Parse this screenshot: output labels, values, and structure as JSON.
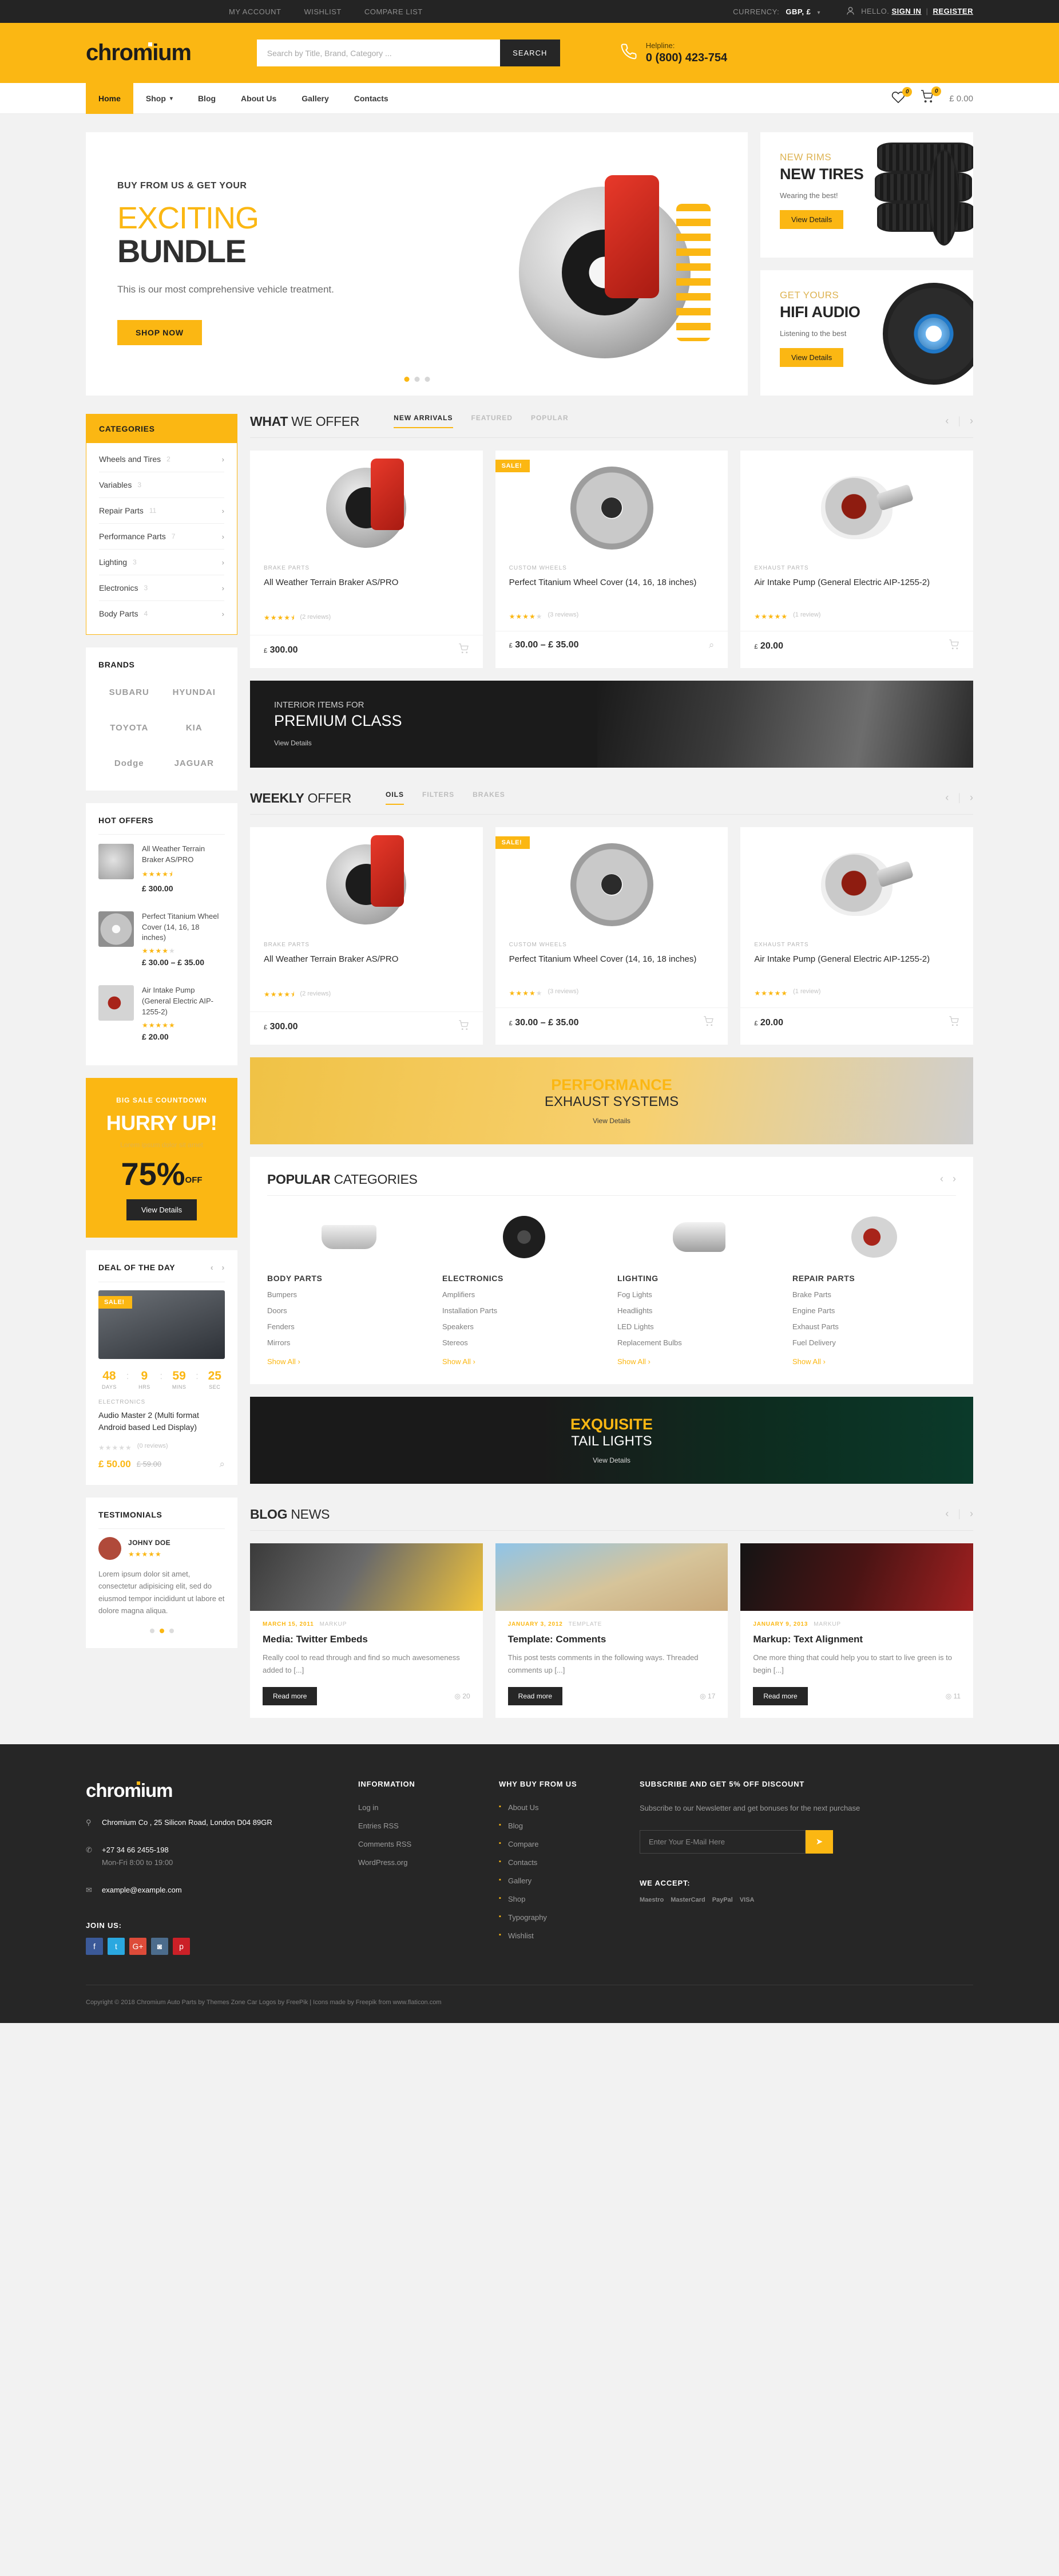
{
  "topbar": {
    "links": [
      "MY ACCOUNT",
      "WISHLIST",
      "COMPARE LIST"
    ],
    "currency_label": "CURRENCY:",
    "currency_value": "GBP, £",
    "hello": "HELLO.",
    "signin": "SIGN IN",
    "separator": "|",
    "register": "REGISTER"
  },
  "header": {
    "logo": "chromium",
    "search_placeholder": "Search by Title, Brand, Category ...",
    "search_button": "SEARCH",
    "helpline_label": "Helpline:",
    "helpline_number": "0 (800) 423-754"
  },
  "nav": {
    "items": [
      "Home",
      "Shop",
      "Blog",
      "About Us",
      "Gallery",
      "Contacts"
    ],
    "wishlist_count": "0",
    "cart_count": "0",
    "cart_total": "£ 0.00"
  },
  "hero": {
    "sup": "BUY FROM US & GET YOUR",
    "h1": "EXCITING",
    "h2": "BUNDLE",
    "p": "This is our most comprehensive vehicle treatment.",
    "cta": "SHOP NOW"
  },
  "promos": [
    {
      "sup": "NEW RIMS",
      "title": "NEW TIRES",
      "sub": "Wearing the best!",
      "cta": "View Details"
    },
    {
      "sup": "GET YOURS",
      "title": "HIFI AUDIO",
      "sub": "Listening to the best",
      "cta": "View Details"
    }
  ],
  "categories": {
    "title": "CATEGORIES",
    "items": [
      {
        "label": "Wheels and Tires",
        "count": "2",
        "arrow": true
      },
      {
        "label": "Variables",
        "count": "3",
        "arrow": false
      },
      {
        "label": "Repair Parts",
        "count": "11",
        "arrow": true
      },
      {
        "label": "Performance Parts",
        "count": "7",
        "arrow": true
      },
      {
        "label": "Lighting",
        "count": "3",
        "arrow": true
      },
      {
        "label": "Electronics",
        "count": "3",
        "arrow": true
      },
      {
        "label": "Body Parts",
        "count": "4",
        "arrow": true
      }
    ]
  },
  "brands": {
    "title": "BRANDS",
    "items": [
      "SUBARU",
      "HYUNDAI",
      "TOYOTA",
      "KIA",
      "Dodge",
      "JAGUAR"
    ]
  },
  "hot_offers": {
    "title": "HOT OFFERS",
    "items": [
      {
        "name": "All Weather Terrain Braker AS/PRO",
        "stars": 4.5,
        "price": "£ 300.00"
      },
      {
        "name": "Perfect Titanium Wheel Cover (14, 16, 18 inches)",
        "stars": 4,
        "price": "£ 30.00 – £ 35.00"
      },
      {
        "name": "Air Intake Pump (General Electric AIP-1255-2)",
        "stars": 5,
        "price": "£ 20.00"
      }
    ]
  },
  "sale_box": {
    "sup": "BIG SALE COUNTDOWN",
    "headline": "HURRY UP!",
    "text": "Lorem ipsum dolor sit amet",
    "percent": "75%",
    "off": "OFF",
    "cta": "View Details"
  },
  "deal_of_day": {
    "title": "DEAL OF THE DAY",
    "badge": "SALE!",
    "countdown": [
      {
        "num": "48",
        "label": "DAYS"
      },
      {
        "num": "9",
        "label": "HRS"
      },
      {
        "num": "59",
        "label": "MINS"
      },
      {
        "num": "25",
        "label": "SEC"
      }
    ],
    "eyebrow": "ELECTRONICS",
    "name": "Audio Master 2 (Multi format Android based Led Display)",
    "reviews": "(0 reviews)",
    "price_new": "£ 50.00",
    "price_old": "£ 59.00"
  },
  "testimonials": {
    "title": "TESTIMONIALS",
    "author": "JOHNY DOE",
    "text": "Lorem ipsum dolor sit amet, consectetur adipisicing elit, sed do eiusmod tempor incididunt ut labore et dolore magna aliqua."
  },
  "what_we_offer": {
    "title_bold": "WHAT",
    "title_light": " WE OFFER",
    "tabs": [
      "NEW ARRIVALS",
      "FEATURED",
      "POPULAR"
    ],
    "active_tab": "NEW ARRIVALS",
    "products": [
      {
        "eyebrow": "BRAKE PARTS",
        "name": "All Weather Terrain Braker AS/PRO",
        "stars": 4.5,
        "reviews": "(2 reviews)",
        "price": "300.00",
        "currency": "£",
        "badge": null,
        "action": "cart"
      },
      {
        "eyebrow": "CUSTOM WHEELS",
        "name": "Perfect Titanium Wheel Cover (14, 16, 18 inches)",
        "stars": 4,
        "reviews": "(3 reviews)",
        "price": "30.00 – £ 35.00",
        "currency": "£",
        "badge": "SALE!",
        "action": "view"
      },
      {
        "eyebrow": "EXHAUST PARTS",
        "name": "Air Intake Pump (General Electric AIP-1255-2)",
        "stars": 5,
        "reviews": "(1 review)",
        "price": "20.00",
        "currency": "£",
        "badge": null,
        "action": "cart"
      }
    ]
  },
  "banner_interior": {
    "sup": "INTERIOR ITEMS FOR",
    "h_gold": "PREMIUM",
    "h_white": " CLASS",
    "link": "View Details"
  },
  "weekly_offer": {
    "title_bold": "WEEKLY",
    "title_light": " OFFER",
    "tabs": [
      "OILS",
      "FILTERS",
      "BRAKES"
    ],
    "active_tab": "OILS",
    "products": [
      {
        "eyebrow": "BRAKE PARTS",
        "name": "All Weather Terrain Braker AS/PRO",
        "stars": 4.5,
        "reviews": "(2 reviews)",
        "price": "300.00",
        "currency": "£",
        "badge": null,
        "action": "cart"
      },
      {
        "eyebrow": "CUSTOM WHEELS",
        "name": "Perfect Titanium Wheel Cover (14, 16, 18 inches)",
        "stars": 4,
        "reviews": "(3 reviews)",
        "price": "30.00 – £ 35.00",
        "currency": "£",
        "badge": "SALE!",
        "action": "cart"
      },
      {
        "eyebrow": "EXHAUST PARTS",
        "name": "Air Intake Pump (General Electric AIP-1255-2)",
        "stars": 5,
        "reviews": "(1 review)",
        "price": "20.00",
        "currency": "£",
        "badge": null,
        "action": "cart"
      }
    ]
  },
  "banner_exhaust": {
    "h_gold": "PERFORMANCE",
    "h_dark": "EXHAUST SYSTEMS",
    "link": "View Details"
  },
  "popular_categories": {
    "title_bold": "POPULAR",
    "title_light": " CATEGORIES",
    "columns": [
      {
        "heading": "BODY PARTS",
        "links": [
          "Bumpers",
          "Doors",
          "Fenders",
          "Mirrors"
        ],
        "show_all": "Show All ›"
      },
      {
        "heading": "ELECTRONICS",
        "links": [
          "Amplifiers",
          "Installation Parts",
          "Speakers",
          "Stereos"
        ],
        "show_all": "Show All ›"
      },
      {
        "heading": "LIGHTING",
        "links": [
          "Fog Lights",
          "Headlights",
          "LED Lights",
          "Replacement Bulbs"
        ],
        "show_all": "Show All ›"
      },
      {
        "heading": "REPAIR PARTS",
        "links": [
          "Brake Parts",
          "Engine Parts",
          "Exhaust Parts",
          "Fuel Delivery"
        ],
        "show_all": "Show All ›"
      }
    ]
  },
  "banner_tail": {
    "h_gold": "EXQUISITE",
    "h_white": "TAIL LIGHTS",
    "link": "View Details"
  },
  "blog": {
    "title_bold": "BLOG",
    "title_light": " NEWS",
    "posts": [
      {
        "date": "MARCH 15, 2011",
        "cat": "MARKUP",
        "title": "Media: Twitter Embeds",
        "excerpt": "Really cool to read through and find so much awesomeness added to [...]",
        "cta": "Read more",
        "views": "20"
      },
      {
        "date": "JANUARY 3, 2012",
        "cat": "TEMPLATE",
        "title": "Template: Comments",
        "excerpt": "This post tests comments in the following ways. Threaded comments up [...]",
        "cta": "Read more",
        "views": "17"
      },
      {
        "date": "JANUARY 9, 2013",
        "cat": "MARKUP",
        "title": "Markup: Text Alignment",
        "excerpt": "One more thing that could help you to start to live green is to begin [...]",
        "cta": "Read more",
        "views": "11"
      }
    ]
  },
  "footer": {
    "logo": "chromium",
    "address": "Chromium Co , 25 Silicon Road, London D04 89GR",
    "phone": "+27 34 66 2455-198",
    "hours": "Mon-Fri 8:00 to 19:00",
    "email": "example@example.com",
    "join_label": "JOIN US:",
    "socials": [
      "f",
      "t",
      "G+",
      "◙",
      "p"
    ],
    "information": {
      "heading": "INFORMATION",
      "links": [
        "Log in",
        "Entries RSS",
        "Comments RSS",
        "WordPress.org"
      ]
    },
    "why_buy": {
      "heading": "WHY BUY FROM US",
      "links": [
        "About Us",
        "Blog",
        "Compare",
        "Contacts",
        "Gallery",
        "Shop",
        "Typography",
        "Wishlist"
      ]
    },
    "newsletter": {
      "heading": "SUBSCRIBE AND GET 5% OFF DISCOUNT",
      "text": "Subscribe to our Newsletter and get bonuses for the next purchase",
      "placeholder": "Enter Your E-Mail Here"
    },
    "accept_label": "WE ACCEPT:",
    "payments": [
      "Maestro",
      "MasterCard",
      "PayPal",
      "VISA"
    ],
    "copyright": "Copyright © 2018  Chromium Auto Parts by Themes Zone Car Logos by FreePik | Icons made by Freepik from www.flaticon.com"
  },
  "colors": {
    "accent": "#fbb713",
    "dark": "#262626",
    "topbar": "#242424"
  }
}
